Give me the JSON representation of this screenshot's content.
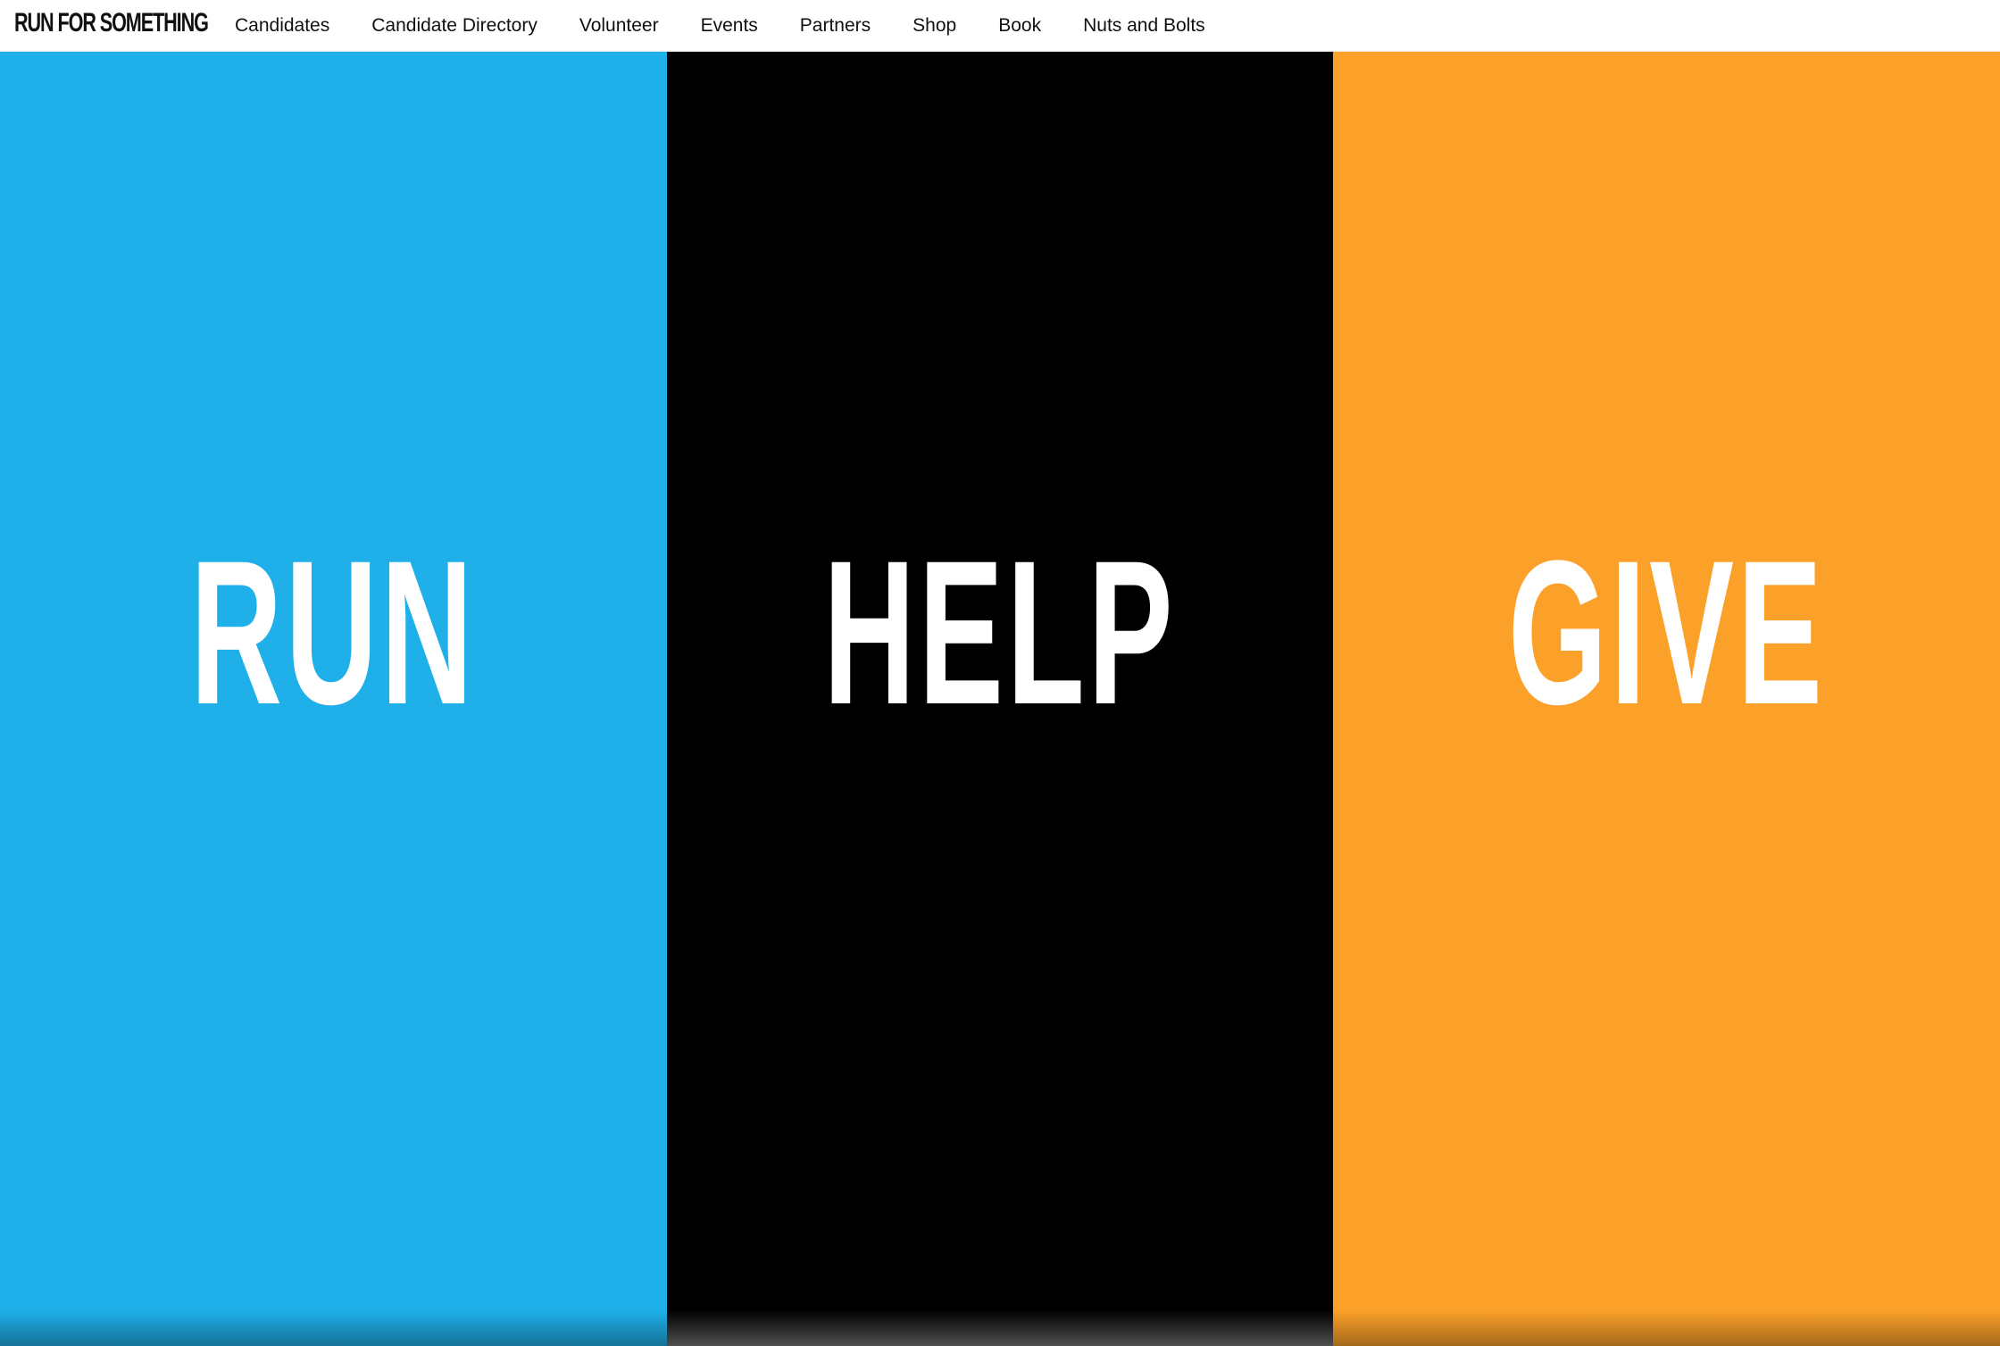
{
  "header": {
    "logo_text": "RUN FOR SOMETHING",
    "nav": [
      {
        "label": "Candidates"
      },
      {
        "label": "Candidate Directory"
      },
      {
        "label": "Volunteer"
      },
      {
        "label": "Events"
      },
      {
        "label": "Partners"
      },
      {
        "label": "Shop"
      },
      {
        "label": "Book"
      },
      {
        "label": "Nuts and Bolts"
      }
    ]
  },
  "panels": [
    {
      "label": "RUN",
      "color": "#1fafe9"
    },
    {
      "label": "HELP",
      "color": "#000000"
    },
    {
      "label": "GIVE",
      "color": "#fba12a"
    }
  ]
}
